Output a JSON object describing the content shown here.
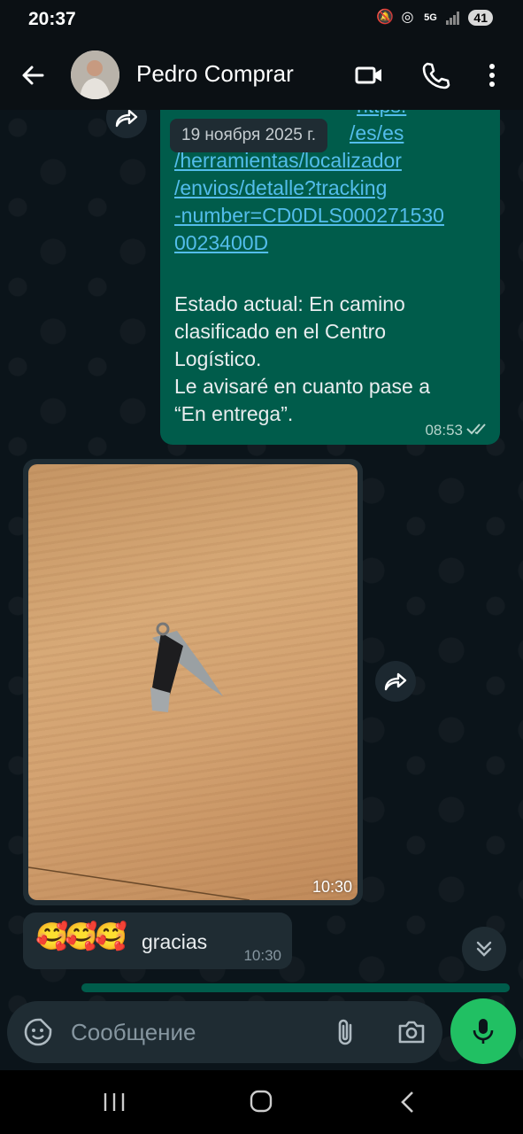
{
  "status_bar": {
    "time": "20:37",
    "network": "5G",
    "battery": "41"
  },
  "header": {
    "contact_name": "Pedro Comprar"
  },
  "messages": {
    "outgoing": {
      "link_lines": [
        "https:",
        "/es/es",
        "/herramientas/localizador",
        "/envios/detalle?tracking",
        "-number=CD0DLS000271530",
        "0023400D"
      ],
      "text_lines": [
        "Estado actual: En camino",
        "clasificado en el Centro",
        "Logístico.",
        "Le avisaré en cuanto pase a",
        "“En entrega”."
      ],
      "time": "08:53"
    },
    "date_chip": "19 ноября 2025 г.",
    "image": {
      "time": "10:30"
    },
    "incoming": {
      "emojis": "🥰🥰🥰",
      "text": "gracias",
      "time": "10:30"
    }
  },
  "composer": {
    "placeholder": "Сообщение"
  },
  "colors": {
    "outgoing_bubble": "#005c4b",
    "incoming_bubble": "#1f2c33",
    "link": "#53bdeb",
    "mic_button": "#21c063"
  }
}
